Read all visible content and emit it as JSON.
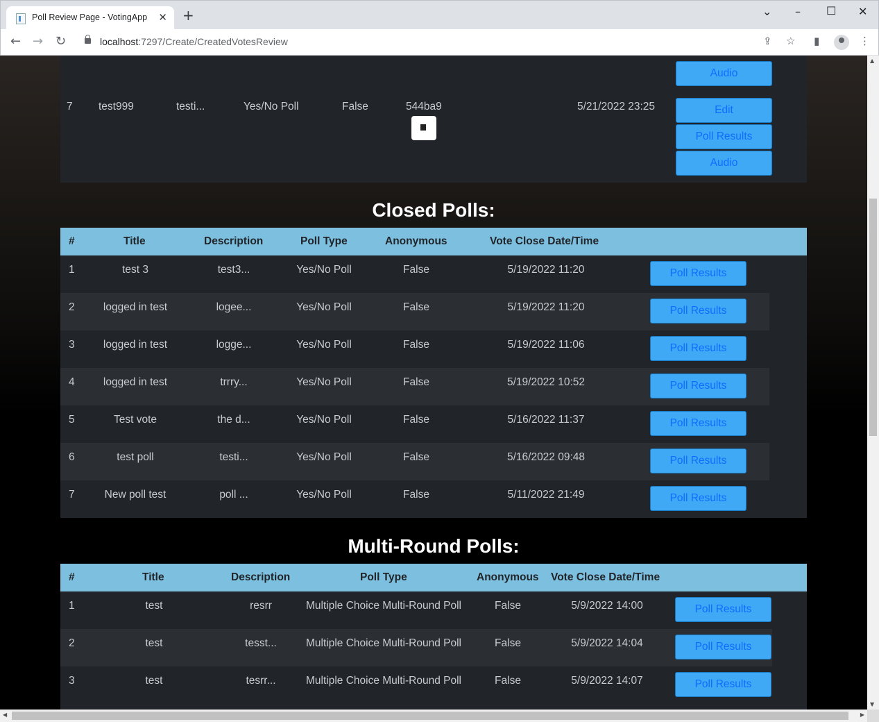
{
  "browser": {
    "tab_title": "Poll Review Page - VotingApp",
    "url_host": "localhost",
    "url_path": ":7297/Create/CreatedVotesReview"
  },
  "open_polls_tail": {
    "top_button": "Audio",
    "row": {
      "num": "7",
      "title": "test999",
      "description": "testi...",
      "poll_type": "Yes/No Poll",
      "anonymous": "False",
      "code": "544ba9",
      "close_time": "5/21/2022 23:25",
      "buttons": [
        "Edit",
        "Poll Results",
        "Audio"
      ]
    }
  },
  "closed": {
    "title": "Closed Polls:",
    "headers": [
      "#",
      "Title",
      "Description",
      "Poll Type",
      "Anonymous",
      "Vote Close Date/Time"
    ],
    "button_label": "Poll Results",
    "rows": [
      {
        "num": "1",
        "title": "test 3",
        "description": "test3...",
        "poll_type": "Yes/No Poll",
        "anonymous": "False",
        "close_time": "5/19/2022 11:20"
      },
      {
        "num": "2",
        "title": "logged in test",
        "description": "logee...",
        "poll_type": "Yes/No Poll",
        "anonymous": "False",
        "close_time": "5/19/2022 11:20"
      },
      {
        "num": "3",
        "title": "logged in test",
        "description": "logge...",
        "poll_type": "Yes/No Poll",
        "anonymous": "False",
        "close_time": "5/19/2022 11:06"
      },
      {
        "num": "4",
        "title": "logged in test",
        "description": "trrry...",
        "poll_type": "Yes/No Poll",
        "anonymous": "False",
        "close_time": "5/19/2022 10:52"
      },
      {
        "num": "5",
        "title": "Test vote",
        "description": "the d...",
        "poll_type": "Yes/No Poll",
        "anonymous": "False",
        "close_time": "5/16/2022 11:37"
      },
      {
        "num": "6",
        "title": "test poll",
        "description": "testi...",
        "poll_type": "Yes/No Poll",
        "anonymous": "False",
        "close_time": "5/16/2022 09:48"
      },
      {
        "num": "7",
        "title": "New poll test",
        "description": "poll ...",
        "poll_type": "Yes/No Poll",
        "anonymous": "False",
        "close_time": "5/11/2022 21:49"
      }
    ]
  },
  "multi": {
    "title": "Multi-Round Polls:",
    "headers": [
      "#",
      "Title",
      "Description",
      "Poll Type",
      "Anonymous",
      "Vote Close Date/Time"
    ],
    "button_label": "Poll Results",
    "rows": [
      {
        "num": "1",
        "title": "test",
        "description": "resrr",
        "poll_type": "Multiple Choice Multi-Round Poll",
        "anonymous": "False",
        "close_time": "5/9/2022 14:00"
      },
      {
        "num": "2",
        "title": "test",
        "description": "tesst...",
        "poll_type": "Multiple Choice Multi-Round Poll",
        "anonymous": "False",
        "close_time": "5/9/2022 14:04"
      },
      {
        "num": "3",
        "title": "test",
        "description": "tesrr...",
        "poll_type": "Multiple Choice Multi-Round Poll",
        "anonymous": "False",
        "close_time": "5/9/2022 14:07"
      }
    ]
  }
}
